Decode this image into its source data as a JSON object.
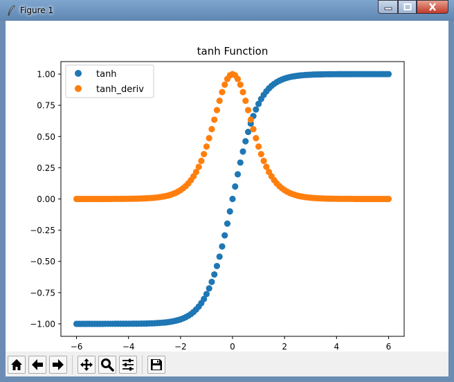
{
  "window": {
    "title": "Figure 1",
    "controls": [
      "minimize",
      "maximize",
      "close"
    ]
  },
  "toolbar": {
    "buttons": [
      {
        "name": "home",
        "icon": "home-icon"
      },
      {
        "name": "back",
        "icon": "arrow-left-icon"
      },
      {
        "name": "forward",
        "icon": "arrow-right-icon"
      },
      {
        "name": "pan",
        "icon": "move-icon"
      },
      {
        "name": "zoom",
        "icon": "zoom-icon"
      },
      {
        "name": "configure-subplots",
        "icon": "sliders-icon"
      },
      {
        "name": "save",
        "icon": "floppy-icon"
      }
    ]
  },
  "chart_data": {
    "type": "scatter",
    "title": "tanh Function",
    "xlabel": "",
    "ylabel": "",
    "xlim": [
      -6.6,
      6.6
    ],
    "ylim": [
      -1.1,
      1.1
    ],
    "xticks": [
      -6,
      -4,
      -2,
      0,
      2,
      4,
      6
    ],
    "xtick_labels": [
      "−6",
      "−4",
      "−2",
      "0",
      "2",
      "4",
      "6"
    ],
    "yticks": [
      -1.0,
      -0.75,
      -0.5,
      -0.25,
      0.0,
      0.25,
      0.5,
      0.75,
      1.0
    ],
    "ytick_labels": [
      "−1.00",
      "−0.75",
      "−0.50",
      "−0.25",
      "0.00",
      "0.25",
      "0.50",
      "0.75",
      "1.00"
    ],
    "grid": false,
    "legend_position": "top-left",
    "x_range": {
      "start": -6,
      "stop": 6,
      "count": 121
    },
    "series": [
      {
        "name": "tanh",
        "function": "tanh(x)",
        "color": "#1f77b4"
      },
      {
        "name": "tanh_deriv",
        "function": "1 - tanh(x)^2",
        "color": "#ff7f0e"
      }
    ]
  }
}
